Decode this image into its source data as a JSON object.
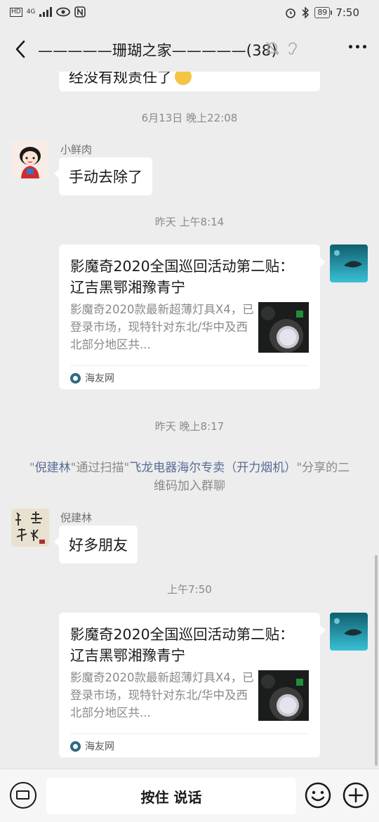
{
  "status_bar": {
    "left_icons": [
      "HD",
      "4G",
      "signal",
      "eye",
      "NFC"
    ],
    "battery": "89",
    "time": "7:50"
  },
  "nav": {
    "title": "—————珊瑚之家—————(38)"
  },
  "messages": {
    "partial_text": "经没有规责任了",
    "time1": "6月13日 晚上22:08",
    "msg1_sender": "小鲜肉",
    "msg1_text": "手动去除了",
    "time2": "昨天 上午8:14",
    "card1": {
      "title": "影魔奇2020全国巡回活动第二贴： 辽吉黑鄂湘豫青宁",
      "desc": "影魔奇2020款最新超薄灯具X4，已登录市场，现特针对东北/华中及西北部分地区共...",
      "source": "海友网"
    },
    "time3": "昨天 晚上8:17",
    "system": {
      "quote_open": "\"",
      "name": "倪建林",
      "middle": "\"通过扫描\"",
      "store": "飞龙电器海尔专卖（开力烟机）",
      "tail": "\"分享的二维码加入群聊"
    },
    "msg2_sender": "倪建林",
    "msg2_text": "好多朋友",
    "time4": "上午7:50",
    "card2": {
      "title": "影魔奇2020全国巡回活动第二贴： 辽吉黑鄂湘豫青宁",
      "desc": "影魔奇2020款最新超薄灯具X4，已登录市场，现特针对东北/华中及西北部分地区共...",
      "source": "海友网"
    }
  },
  "bottom": {
    "hold_to_talk": "按住 说话"
  }
}
